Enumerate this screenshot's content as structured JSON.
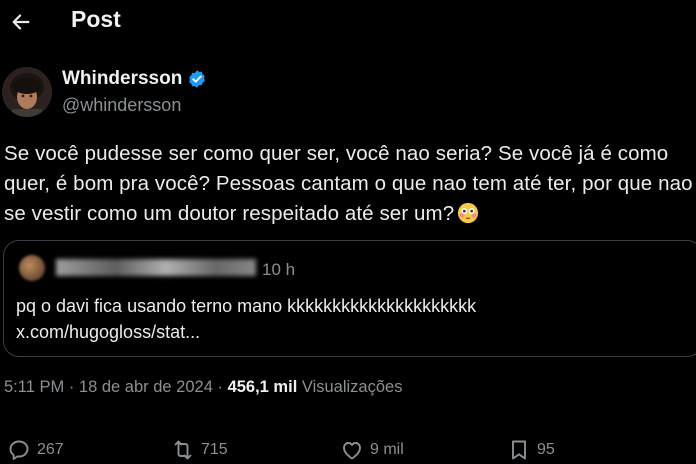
{
  "header": {
    "title": "Post"
  },
  "author": {
    "name": "Whindersson",
    "handle": "@whindersson"
  },
  "tweet": {
    "text": "Se você pudesse ser como quer ser, você nao seria? Se você já é como quer, é bom pra você? Pessoas cantam o que nao tem até ter, por que nao se vestir como um doutor respeitado até ser um?"
  },
  "quote": {
    "time": "10 h",
    "line1": "pq o davi fica usando terno mano kkkkkkkkkkkkkkkkkkkkk",
    "line2": "x.com/hugogloss/stat..."
  },
  "meta": {
    "time": "5:11 PM",
    "date": "18 de abr de 2024",
    "views_count": "456,1 mil",
    "views_label": "Visualizações"
  },
  "actions": {
    "replies": "267",
    "reposts": "715",
    "likes": "9 mil",
    "bookmarks": "95"
  },
  "colors": {
    "background": "#000000",
    "text": "#e7e9ea",
    "secondary": "#8b9095",
    "verified": "#1d9bf0",
    "border": "#3a3d41"
  },
  "icons": [
    "back-arrow-icon",
    "verified-badge-icon",
    "flushed-face-emoji",
    "reply-icon",
    "repost-icon",
    "like-icon",
    "bookmark-icon"
  ]
}
